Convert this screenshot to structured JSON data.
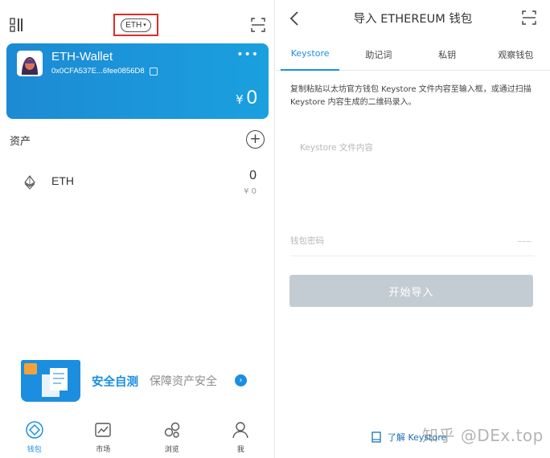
{
  "left": {
    "header": {
      "chain_label": "ETH",
      "menu_icon": "grid-menu-icon",
      "scan_icon": "scan-icon"
    },
    "wallet": {
      "name": "ETH-Wallet",
      "address": "0x0CFA537E...6fee0856D8",
      "balance_currency": "¥",
      "balance_value": "0",
      "more_icon": "more-dots-icon"
    },
    "assets": {
      "title": "资产",
      "items": [
        {
          "symbol": "ETH",
          "amount": "0",
          "fiat": "¥ 0"
        }
      ]
    },
    "banner": {
      "title": "安全自测",
      "subtitle": "保障资产安全"
    },
    "tabbar": [
      {
        "label": "钱包",
        "icon": "wallet-icon",
        "active": true
      },
      {
        "label": "市场",
        "icon": "market-chart-icon",
        "active": false
      },
      {
        "label": "浏览",
        "icon": "browse-icon",
        "active": false
      },
      {
        "label": "我",
        "icon": "profile-icon",
        "active": false
      }
    ]
  },
  "right": {
    "title": "导入 ETHEREUM 钱包",
    "tabs": [
      "Keystore",
      "助记词",
      "私钥",
      "观察钱包"
    ],
    "active_tab": "Keystore",
    "instruction": "复制粘贴以太坊官方钱包 Keystore 文件内容至输入框，或通过扫描 Keystore 内容生成的二维码录入。",
    "keystore_placeholder": "Keystore 文件内容",
    "password_placeholder": "钱包密码",
    "import_button": "开始导入",
    "learn_link": "了解 Keystore",
    "watermark": "知乎 @DEx.top"
  },
  "colors": {
    "accent": "#1a8fe0",
    "highlight_box": "#e02a2a",
    "disabled_button": "#c4ccd3"
  }
}
